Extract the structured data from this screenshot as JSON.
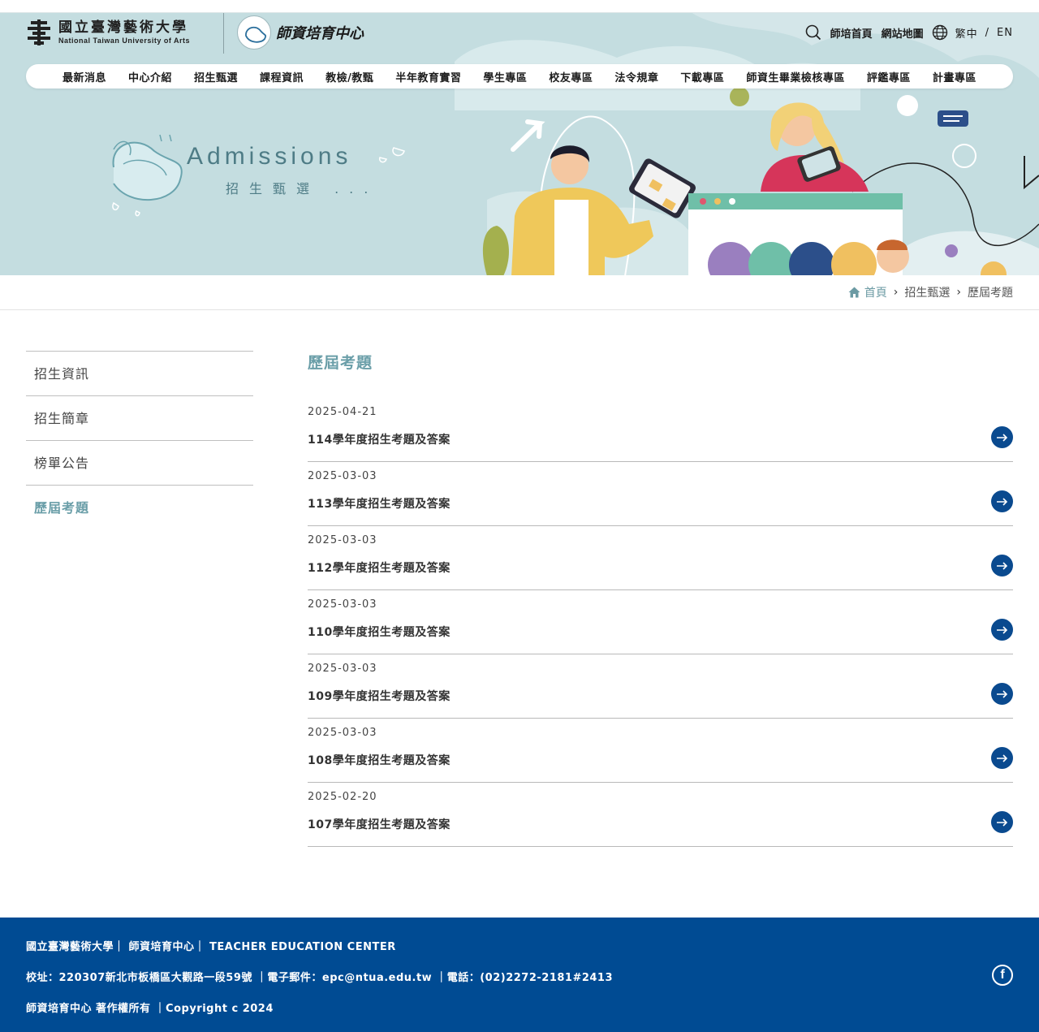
{
  "header": {
    "logo_zh": "國立臺灣藝術大學",
    "logo_en": "National Taiwan University of Arts",
    "center_logo_text": "師資培育中心",
    "top_links": [
      "師培首頁",
      "網站地圖"
    ],
    "lang_zh": "繁中",
    "lang_sep": "/",
    "lang_en": "EN"
  },
  "nav": {
    "items": [
      "最新消息",
      "中心介紹",
      "招生甄選",
      "課程資訊",
      "教檢/教甄",
      "半年教育實習",
      "學生專區",
      "校友專區",
      "法令規章",
      "下載專區",
      "師資生畢業檢核專區",
      "評鑑專區",
      "計畫專區"
    ]
  },
  "banner": {
    "title": "Admissions",
    "subtitle": "招生甄選 ..."
  },
  "breadcrumb": {
    "home": "首頁",
    "section": "招生甄選",
    "current": "歷屆考題"
  },
  "sidebar": {
    "items": [
      "招生資訊",
      "招生簡章",
      "榜單公告",
      "歷屆考題"
    ]
  },
  "main": {
    "title": "歷屆考題",
    "rows": [
      {
        "date": "2025-04-21",
        "title": "114學年度招生考題及答案"
      },
      {
        "date": "2025-03-03",
        "title": "113學年度招生考題及答案"
      },
      {
        "date": "2025-03-03",
        "title": "112學年度招生考題及答案"
      },
      {
        "date": "2025-03-03",
        "title": "110學年度招生考題及答案"
      },
      {
        "date": "2025-03-03",
        "title": "109學年度招生考題及答案"
      },
      {
        "date": "2025-03-03",
        "title": "108學年度招生考題及答案"
      },
      {
        "date": "2025-02-20",
        "title": "107學年度招生考題及答案"
      }
    ]
  },
  "footer": {
    "line1": "國立臺灣藝術大學｜ 師資培育中心｜ TEACHER EDUCATION CENTER",
    "line2": "校址：220307新北市板橋區大觀路一段59號 ｜電子郵件：epc@ntua.edu.tw ｜電話：(02)2272-2181#2413",
    "line3": "師資培育中心 著作權所有 ｜Copyright c 2024",
    "facebook": "f"
  },
  "colors": {
    "accent": "#6a9ea8",
    "footer": "#004b93",
    "arrow": "#0a4a8f",
    "hero_bg": "#c4dde0"
  }
}
